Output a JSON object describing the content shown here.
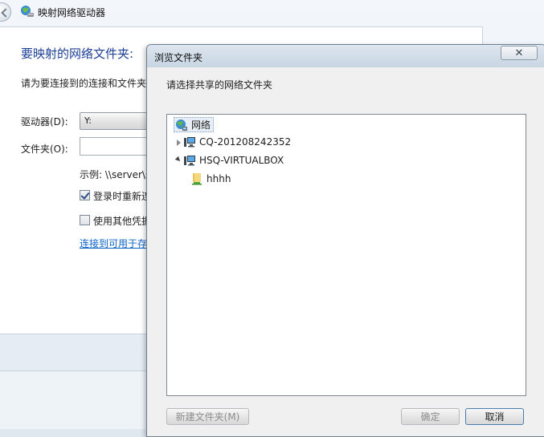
{
  "wizard": {
    "title": "映射网络驱动器",
    "heading": "要映射的网络文件夹:",
    "description": "请为要连接到的连接和文件夹",
    "drive_label": "驱动器(D):",
    "drive_value": "Y:",
    "folder_label": "文件夹(O):",
    "folder_value": "",
    "example": "示例: \\\\server\\s",
    "reconnect_label": "登录时重新连",
    "reconnect_checked": true,
    "other_credentials_label": "使用其他凭据",
    "other_credentials_checked": false,
    "link_text": "连接到可用于存"
  },
  "dialog": {
    "title": "浏览文件夹",
    "close_symbol": "✕",
    "prompt": "请选择共享的网络文件夹",
    "tree": {
      "root": "网络",
      "items": [
        {
          "label": "CQ-201208242352",
          "expanded": false
        },
        {
          "label": "HSQ-VIRTUALBOX",
          "expanded": true,
          "children": [
            {
              "label": "hhhh"
            }
          ]
        }
      ]
    },
    "buttons": {
      "new_folder": "新建文件夹(M)",
      "ok": "确定",
      "cancel": "取消"
    }
  },
  "icons": {
    "network": "network-globe-icon",
    "computer": "computer-icon",
    "share": "shared-folder-icon",
    "wizard": "map-network-drive-icon"
  }
}
